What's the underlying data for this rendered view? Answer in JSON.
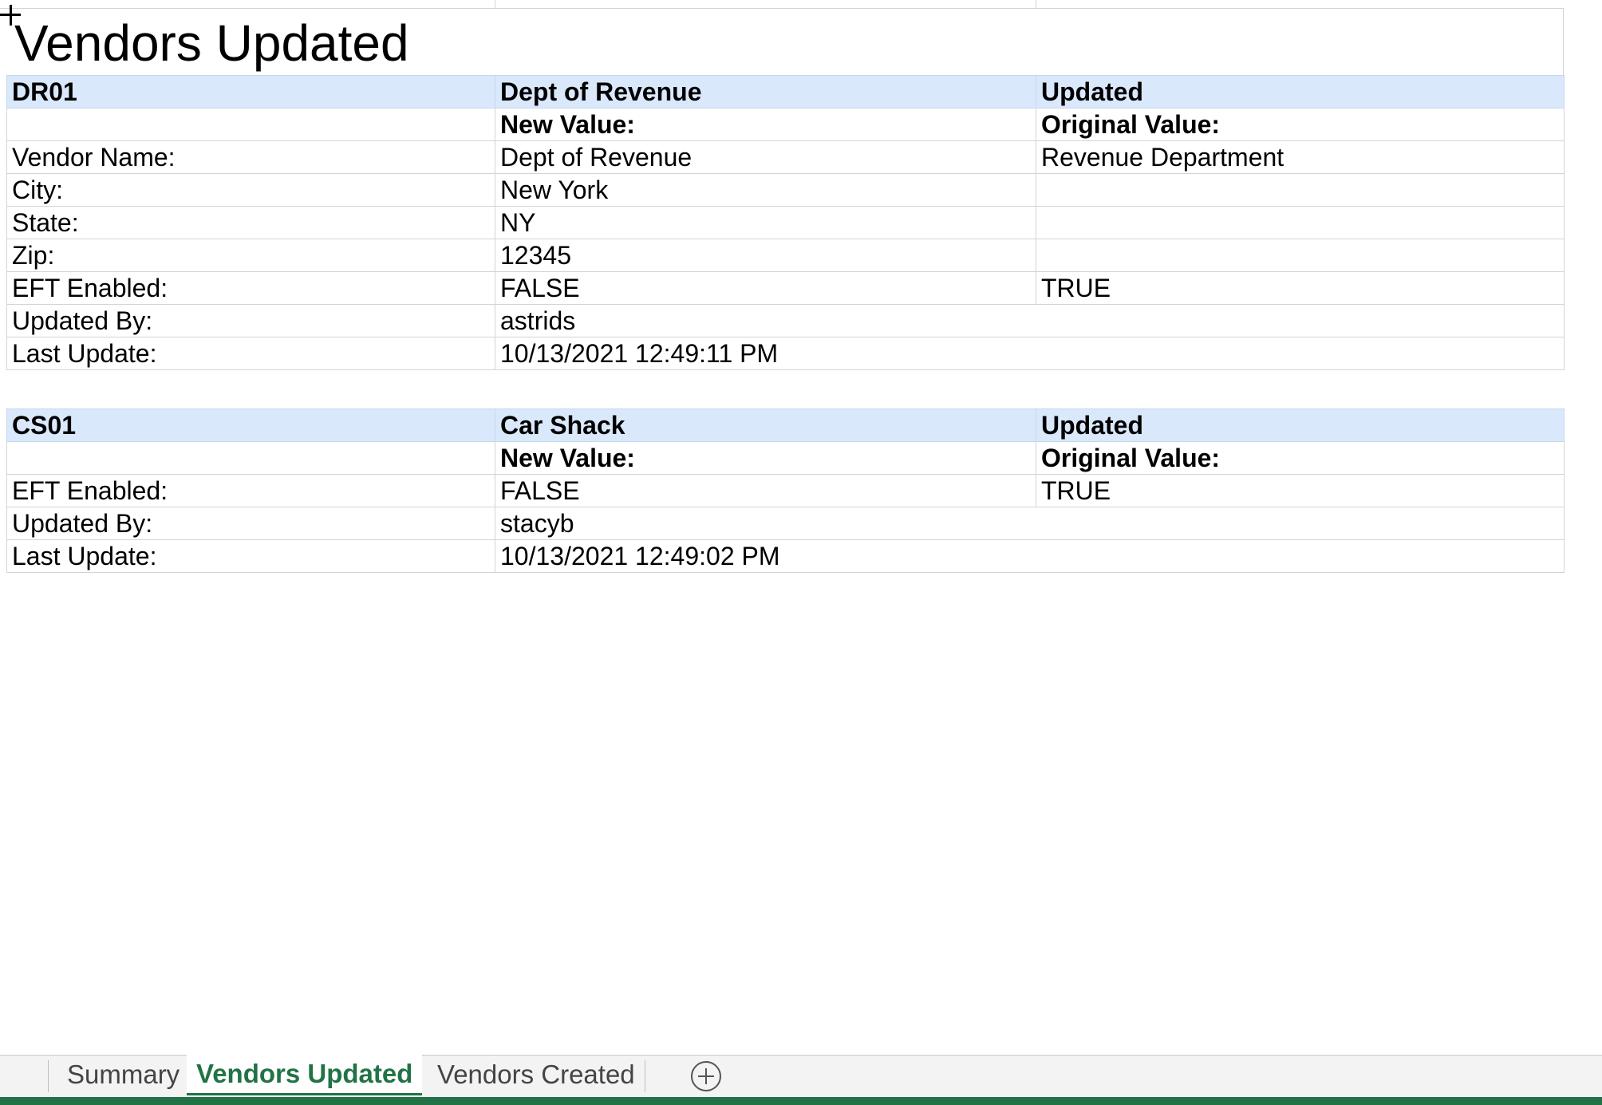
{
  "report_title": "Vendors Updated",
  "vendors": [
    {
      "id": "DR01",
      "name": "Dept of Revenue",
      "status": "Updated",
      "new_value_header": "New Value:",
      "original_value_header": "Original Value:",
      "fields": [
        {
          "label": "Vendor Name:",
          "new": "Dept of Revenue",
          "original": "Revenue Department"
        },
        {
          "label": "City:",
          "new": "New York",
          "original": ""
        },
        {
          "label": "State:",
          "new": "NY",
          "original": ""
        },
        {
          "label": "Zip:",
          "new": "12345",
          "original": ""
        },
        {
          "label": "EFT Enabled:",
          "new": "FALSE",
          "original": "TRUE"
        }
      ],
      "updated_by_label": "Updated By:",
      "updated_by": "astrids",
      "last_update_label": "Last Update:",
      "last_update": "10/13/2021 12:49:11 PM"
    },
    {
      "id": "CS01",
      "name": "Car Shack",
      "status": "Updated",
      "new_value_header": "New Value:",
      "original_value_header": "Original Value:",
      "fields": [
        {
          "label": "EFT Enabled:",
          "new": "FALSE",
          "original": "TRUE"
        }
      ],
      "updated_by_label": "Updated By:",
      "updated_by": "stacyb",
      "last_update_label": "Last Update:",
      "last_update": "10/13/2021 12:49:02 PM"
    }
  ],
  "sheet_tabs": [
    {
      "label": "Summary",
      "active": false
    },
    {
      "label": "Vendors Updated",
      "active": true
    },
    {
      "label": "Vendors Created",
      "active": false
    }
  ],
  "colors": {
    "header_fill": "#dae8fc",
    "active_tab": "#217346",
    "gridline": "#d4d4d4"
  },
  "icons": {
    "cursor": "cell-select-cursor-icon",
    "add_sheet": "plus-circle-icon"
  }
}
